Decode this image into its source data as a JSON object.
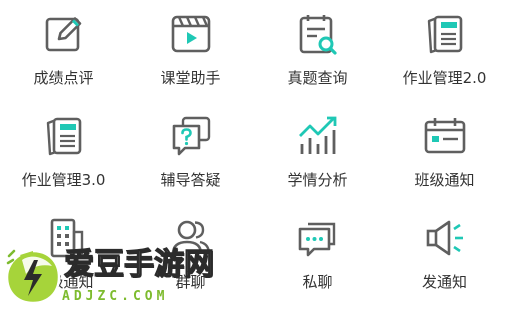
{
  "menu": {
    "items": [
      {
        "label": "成绩点评",
        "icon": "edit-icon"
      },
      {
        "label": "课堂助手",
        "icon": "video-icon"
      },
      {
        "label": "真题查询",
        "icon": "document-search-icon"
      },
      {
        "label": "作业管理2.0",
        "icon": "notebook-icon"
      },
      {
        "label": "作业管理3.0",
        "icon": "notebook-icon"
      },
      {
        "label": "辅导答疑",
        "icon": "question-chat-icon"
      },
      {
        "label": "学情分析",
        "icon": "trend-chart-icon"
      },
      {
        "label": "班级通知",
        "icon": "calendar-notice-icon"
      },
      {
        "label": "校级通知",
        "icon": "building-icon"
      },
      {
        "label": "群聊",
        "icon": "group-icon"
      },
      {
        "label": "私聊",
        "icon": "chat-bubble-icon"
      },
      {
        "label": "发通知",
        "icon": "megaphone-icon"
      }
    ]
  },
  "colors": {
    "accent": "#1fc8b5",
    "icon_stroke": "#5f5f5f",
    "text": "#333333"
  },
  "watermark": {
    "title": "爱豆手游网",
    "domain": "ADJZC.COM"
  }
}
